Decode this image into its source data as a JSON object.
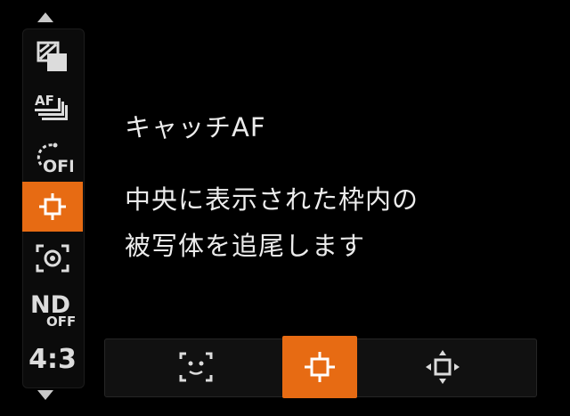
{
  "menu": {
    "items": [
      {
        "name": "picture-effect-icon"
      },
      {
        "name": "af-drive-icon"
      },
      {
        "name": "self-timer-off-icon",
        "label": "OFF"
      },
      {
        "name": "tracking-af-icon",
        "selected": true
      },
      {
        "name": "metering-icon"
      },
      {
        "name": "nd-filter-off-icon",
        "label_top": "ND",
        "label_bottom": "OFF"
      },
      {
        "name": "aspect-ratio",
        "label": "4:3"
      }
    ]
  },
  "info": {
    "title": "キャッチAF",
    "description_line1": "中央に表示された枠内の",
    "description_line2": "被写体を追尾します"
  },
  "options": [
    {
      "name": "face-detection-icon"
    },
    {
      "name": "center-crosshair-icon",
      "selected": true
    },
    {
      "name": "movable-frame-icon"
    }
  ],
  "colors": {
    "accent": "#e76b13",
    "background": "#000000"
  }
}
